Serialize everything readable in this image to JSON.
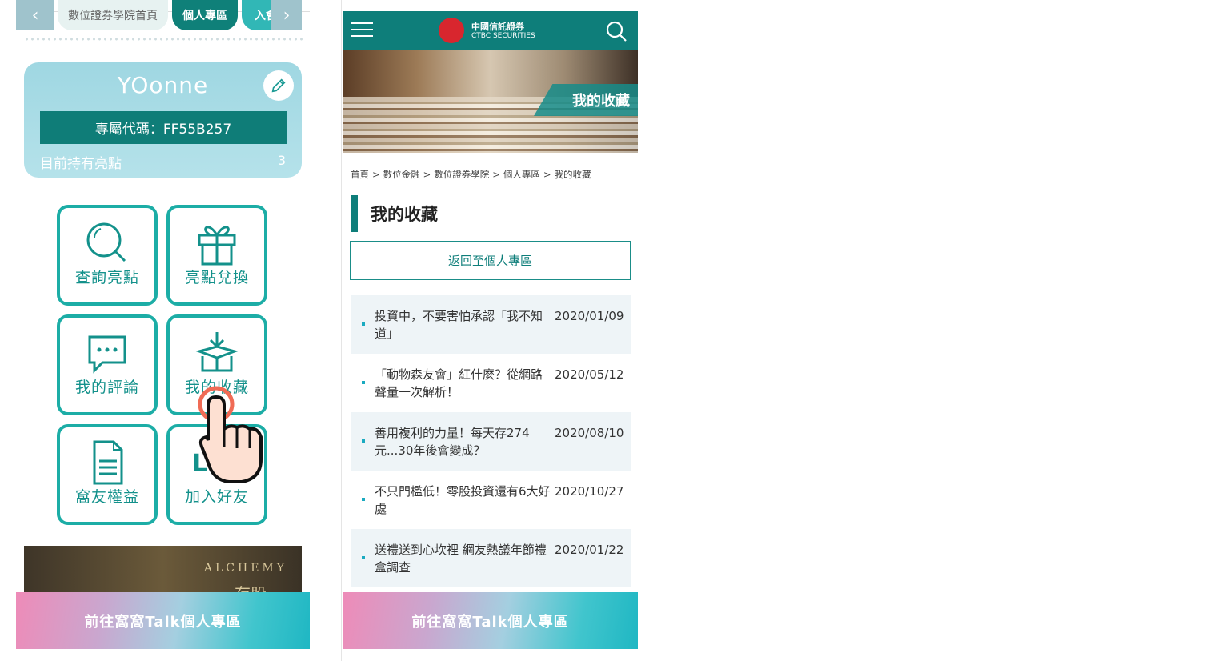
{
  "left": {
    "nav": {
      "prev_icon": "chevron-left-icon",
      "next_icon": "chevron-right-icon",
      "tabs": [
        "數位證券學院首頁",
        "個人專區",
        "入會"
      ]
    },
    "profile": {
      "username": "YOonne",
      "edit_icon": "pencil-icon",
      "code_label": "專屬代碼：FF55B257",
      "points_label": "目前持有亮點",
      "points_value": "3"
    },
    "tiles": [
      {
        "label": "查詢亮點",
        "icon": "search-icon"
      },
      {
        "label": "亮點兌換",
        "icon": "gift-icon"
      },
      {
        "label": "我的評論",
        "icon": "chat-bubble-icon"
      },
      {
        "label": "我的收藏",
        "icon": "box-download-icon"
      },
      {
        "label": "窩友權益",
        "icon": "document-icon"
      },
      {
        "label": "加入好友",
        "icon": "line-icon",
        "partial_text": "LI"
      }
    ],
    "banner_text": "ALCHEMY",
    "banner_sub": "存股",
    "footer": "前往窩窩Talk個人專區"
  },
  "right": {
    "header": {
      "menu_icon": "hamburger-icon",
      "logo_line1": "中國信託證券",
      "logo_line2": "CTBC SECURITIES",
      "search_icon": "search-icon"
    },
    "hero_tag": "我的收藏",
    "breadcrumb": [
      "首頁",
      "數位金融",
      "數位證券學院",
      "個人專區",
      "我的收藏"
    ],
    "breadcrumb_sep": ">",
    "page_title": "我的收藏",
    "back_button": "返回至個人專區",
    "articles": [
      {
        "title": "投資中，不要害怕承認「我不知道」",
        "date": "2020/01/09"
      },
      {
        "title": "「動物森友會」紅什麼？從網路聲量一次解析！",
        "date": "2020/05/12"
      },
      {
        "title": "善用複利的力量！每天存274元...30年後會變成？",
        "date": "2020/08/10"
      },
      {
        "title": "不只門檻低！零股投資還有6大好處",
        "date": "2020/10/27"
      },
      {
        "title": "送禮送到心坎裡 網友熱議年節禮盒調查",
        "date": "2020/01/22"
      }
    ],
    "footer": "前往窩窩Talk個人專區"
  },
  "colors": {
    "primary": "#0e7e7a",
    "accent": "#1cada6",
    "row_shade": "#eef4f7"
  }
}
